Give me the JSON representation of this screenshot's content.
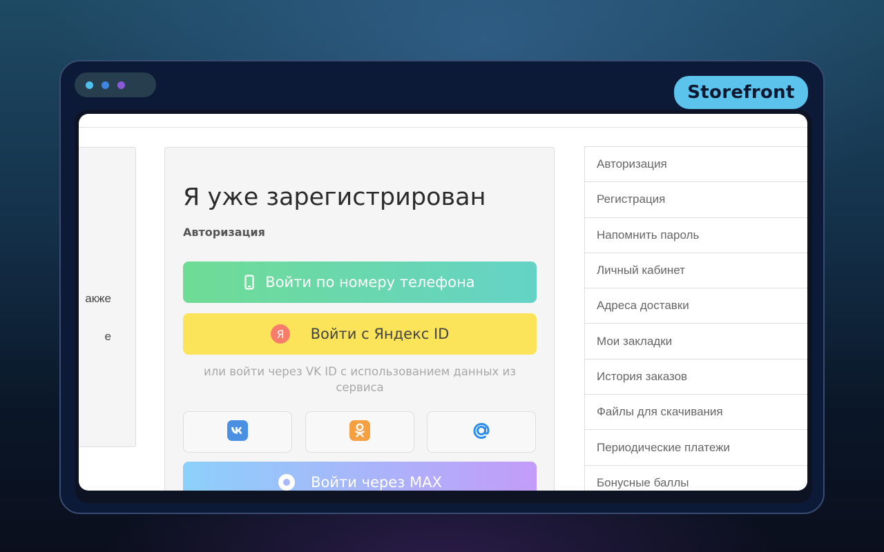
{
  "badge": {
    "label": "Storefront"
  },
  "window_dots": {
    "colors": [
      "#4fc1ec",
      "#3e86e6",
      "#8a5ad8"
    ]
  },
  "left_panel": {
    "lines": [
      "акже",
      "е"
    ]
  },
  "login": {
    "title": "Я уже зарегистрирован",
    "subtitle": "Авторизация",
    "phone_button": "Войти по номеру телефона",
    "yandex_button": "Войти с Яндекс ID",
    "yandex_logo_letter": "Я",
    "vk_note": "или войти через VK ID с использованием данных из сервиса",
    "social": [
      {
        "name": "vk",
        "icon": "vk-icon"
      },
      {
        "name": "ok",
        "icon": "odnoklassniki-icon"
      },
      {
        "name": "mail",
        "icon": "mail-at-icon"
      }
    ],
    "max_button": "Войти через MAX"
  },
  "menu": {
    "items": [
      {
        "label": "Авторизация"
      },
      {
        "label": "Регистрация"
      },
      {
        "label": "Напомнить пароль"
      },
      {
        "label": "Личный кабинет"
      },
      {
        "label": "Адреса доставки"
      },
      {
        "label": "Мои закладки"
      },
      {
        "label": "История заказов"
      },
      {
        "label": "Файлы для скачивания"
      },
      {
        "label": "Периодические платежи"
      },
      {
        "label": "Бонусные баллы"
      }
    ]
  },
  "colors": {
    "phone_gradient": [
      "#6fdc95",
      "#64d3c6"
    ],
    "yandex_yellow": "#fbe45a",
    "max_gradient": [
      "#8cd0fb",
      "#c39cf9"
    ],
    "vk_blue": "#4a90e2",
    "ok_orange": "#f5a043",
    "mail_blue": "#2c8eea"
  }
}
